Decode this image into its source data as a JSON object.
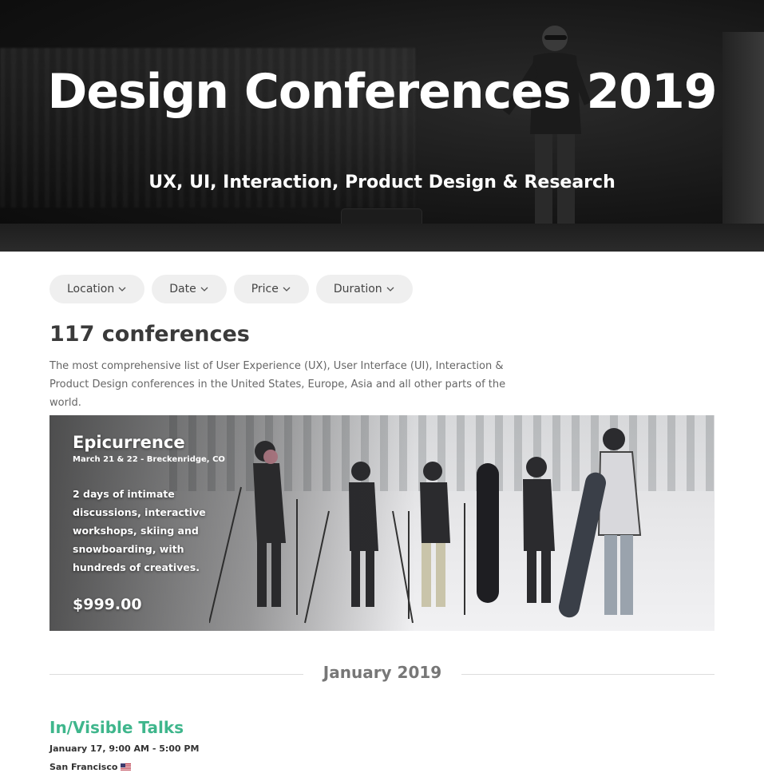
{
  "hero": {
    "title": "Design Conferences 2019",
    "subtitle": "UX, UI, Interaction, Product Design & Research"
  },
  "filters": [
    {
      "label": "Location",
      "icon": "chevron-down-icon"
    },
    {
      "label": "Date",
      "icon": "chevron-down-icon"
    },
    {
      "label": "Price",
      "icon": "chevron-down-icon"
    },
    {
      "label": "Duration",
      "icon": "chevron-down-icon"
    }
  ],
  "summary": {
    "count_text": "117 conferences",
    "description": "The most comprehensive list of User Experience (UX), User Interface (UI), Interaction & Product Design conferences in the United States, Europe, Asia and all other parts of the world."
  },
  "featured": {
    "title": "Epicurrence",
    "meta": "March 21 & 22 - Breckenridge, CO",
    "blurb": "2 days of intimate discussions, interactive workshops, skiing and snowboarding, with hundreds of creatives.",
    "price": "$999.00"
  },
  "month_section": {
    "label": "January 2019"
  },
  "events": [
    {
      "title": "In/Visible Talks",
      "date": "January 17, 9:00 AM - 5:00 PM",
      "location": "San Francisco",
      "flag": "us-flag-icon"
    }
  ],
  "colors": {
    "accent": "#3fb68c",
    "filter_bg": "#efefef",
    "heading": "#3a3a3a"
  }
}
